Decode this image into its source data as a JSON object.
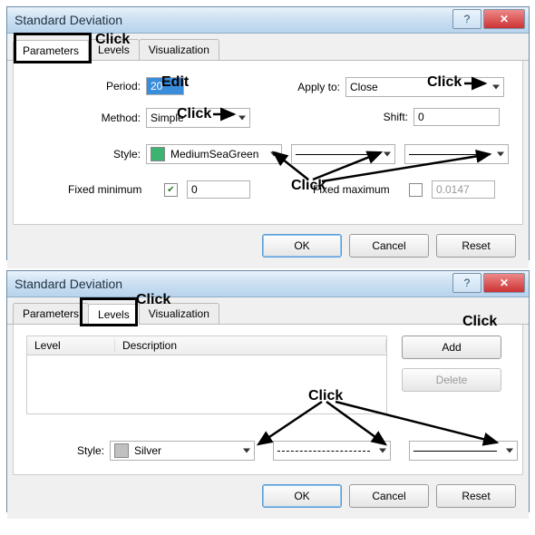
{
  "dialog1": {
    "title": "Standard Deviation",
    "tabs": {
      "parameters": "Parameters",
      "levels": "Levels",
      "visualization": "Visualization"
    },
    "period_label": "Period:",
    "period_value": "20",
    "applyto_label": "Apply to:",
    "applyto_value": "Close",
    "method_label": "Method:",
    "method_value": "Simple",
    "shift_label": "Shift:",
    "shift_value": "0",
    "style_label": "Style:",
    "style_color_name": "MediumSeaGreen",
    "style_color_hex": "#3CB371",
    "fixedmin_label": "Fixed minimum",
    "fixedmin_checked": true,
    "fixedmin_value": "0",
    "fixedmax_label": "Fixed maximum",
    "fixedmax_checked": false,
    "fixedmax_value": "0.0147",
    "buttons": {
      "ok": "OK",
      "cancel": "Cancel",
      "reset": "Reset"
    }
  },
  "dialog2": {
    "title": "Standard Deviation",
    "tabs": {
      "parameters": "Parameters",
      "levels": "Levels",
      "visualization": "Visualization"
    },
    "list": {
      "col_level": "Level",
      "col_desc": "Description"
    },
    "add_btn": "Add",
    "delete_btn": "Delete",
    "style_label": "Style:",
    "style_color_name": "Silver",
    "style_color_hex": "#C0C0C0",
    "buttons": {
      "ok": "OK",
      "cancel": "Cancel",
      "reset": "Reset"
    }
  },
  "annotations": {
    "click": "Click",
    "edit": "Edit"
  }
}
